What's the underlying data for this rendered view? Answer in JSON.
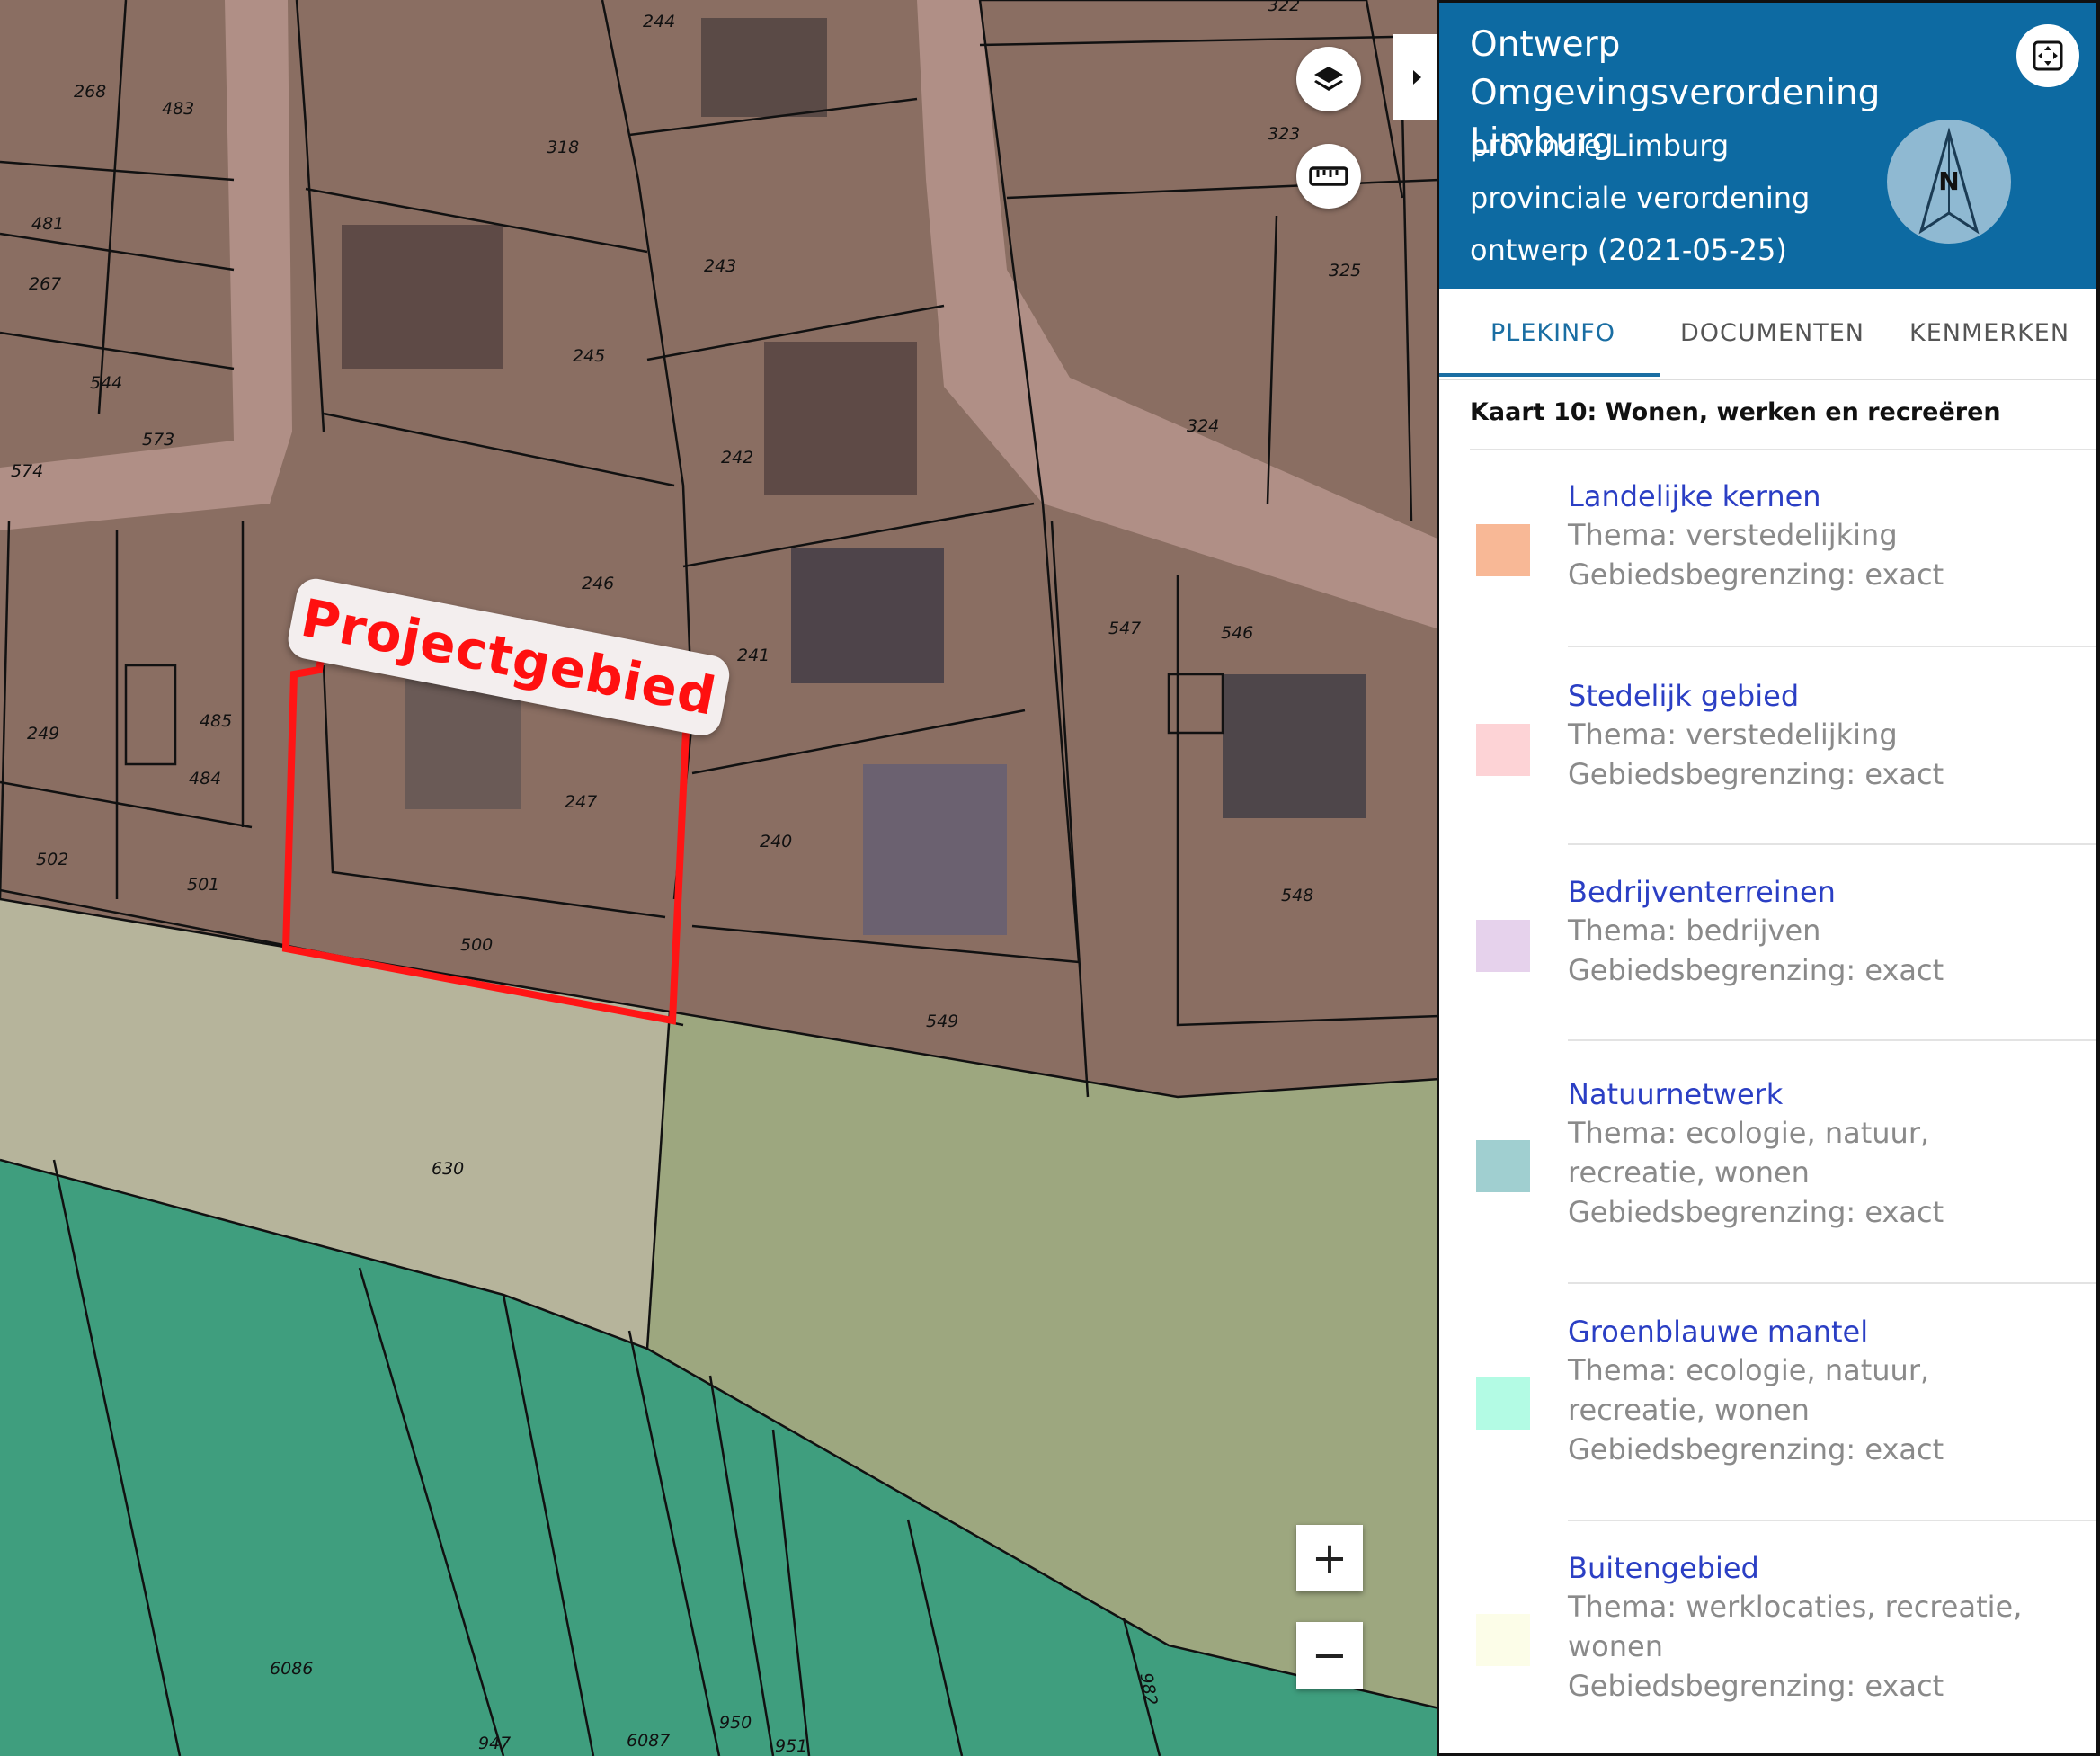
{
  "map": {
    "project_label": "Projectgebied",
    "parcel_numbers": [
      "244",
      "322",
      "268",
      "483",
      "318",
      "481",
      "323",
      "243",
      "267",
      "325",
      "245",
      "544",
      "573",
      "242",
      "324",
      "574",
      "246",
      "241",
      "547",
      "546",
      "249",
      "485",
      "484",
      "247",
      "240",
      "502",
      "501",
      "548",
      "500",
      "549",
      "630",
      "6086",
      "982",
      "950",
      "947",
      "6087",
      "951"
    ],
    "zoom_in": "+",
    "zoom_out": "−",
    "layers_icon": "layers-icon",
    "measure_icon": "ruler-icon",
    "collapse_icon": "caret-right-icon"
  },
  "panel": {
    "title": "Ontwerp Omgevingsverordening Limburg",
    "line1": "provincie Limburg",
    "line2": "provinciale verordening",
    "line3": "ontwerp (2021-05-25)",
    "compass_label": "N",
    "fullscreen_icon": "fullscreen-icon",
    "tabs": [
      {
        "label": "PLEKINFO"
      },
      {
        "label": "DOCUMENTEN"
      },
      {
        "label": "KENMERKEN"
      }
    ],
    "section_title": "Kaart 10: Wonen, werken en recreëren",
    "legend": [
      {
        "title": "Landelijke kernen",
        "thema": "Thema: verstedelijking",
        "begrenzing": "Gebiedsbegrenzing: exact",
        "color": "#f8b896"
      },
      {
        "title": "Stedelijk gebied",
        "thema": "Thema: verstedelijking",
        "begrenzing": "Gebiedsbegrenzing: exact",
        "color": "#fdd3d6"
      },
      {
        "title": "Bedrijventerreinen",
        "thema": "Thema: bedrijven",
        "begrenzing": "Gebiedsbegrenzing: exact",
        "color": "#e6d2ec"
      },
      {
        "title": "Natuurnetwerk",
        "thema": "Thema: ecologie, natuur, recreatie, wonen",
        "begrenzing": "Gebiedsbegrenzing: exact",
        "color": "#a0cfd0"
      },
      {
        "title": "Groenblauwe mantel",
        "thema": "Thema: ecologie, natuur, recreatie, wonen",
        "begrenzing": "Gebiedsbegrenzing: exact",
        "color": "#b3fbe4"
      },
      {
        "title": "Buitengebied",
        "thema": "Thema: werklocaties, recreatie, wonen",
        "begrenzing": "Gebiedsbegrenzing: exact",
        "color": "#fcfde8"
      }
    ]
  }
}
